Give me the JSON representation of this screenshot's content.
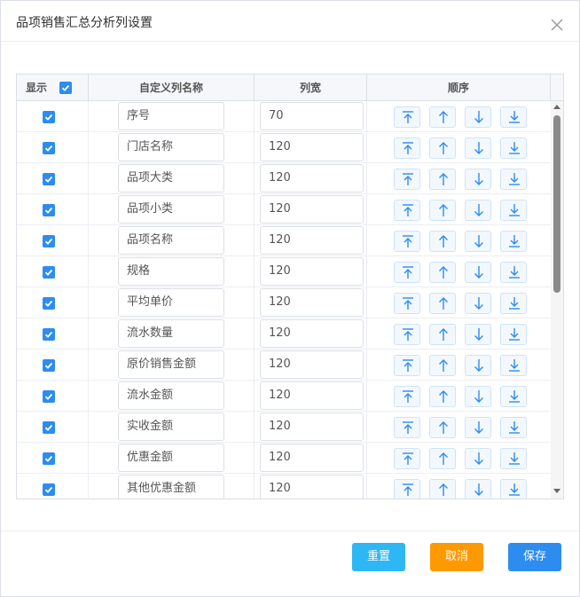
{
  "dialog": {
    "title": "品项销售汇总分析列设置"
  },
  "table": {
    "headers": {
      "show": "显示",
      "name": "自定义列名称",
      "width": "列宽",
      "order": "顺序"
    },
    "rows": [
      {
        "name": "序号",
        "width": "70"
      },
      {
        "name": "门店名称",
        "width": "120"
      },
      {
        "name": "品项大类",
        "width": "120"
      },
      {
        "name": "品项小类",
        "width": "120"
      },
      {
        "name": "品项名称",
        "width": "120"
      },
      {
        "name": "规格",
        "width": "120"
      },
      {
        "name": "平均单价",
        "width": "120"
      },
      {
        "name": "流水数量",
        "width": "120"
      },
      {
        "name": "原价销售金额",
        "width": "120"
      },
      {
        "name": "流水金额",
        "width": "120"
      },
      {
        "name": "实收金额",
        "width": "120"
      },
      {
        "name": "优惠金额",
        "width": "120"
      },
      {
        "name": "其他优惠金额",
        "width": "120"
      }
    ]
  },
  "footer": {
    "reset_label": "重置",
    "cancel_label": "取消",
    "save_label": "保存"
  },
  "colors": {
    "primary": "#2d8cf0",
    "info": "#2db7f5",
    "warning": "#ff9900"
  },
  "icons": {
    "close": "close-icon",
    "checkbox": "checkmark-icon",
    "top": "move-to-top-icon",
    "up": "move-up-icon",
    "down": "move-down-icon",
    "bottom": "move-to-bottom-icon"
  }
}
